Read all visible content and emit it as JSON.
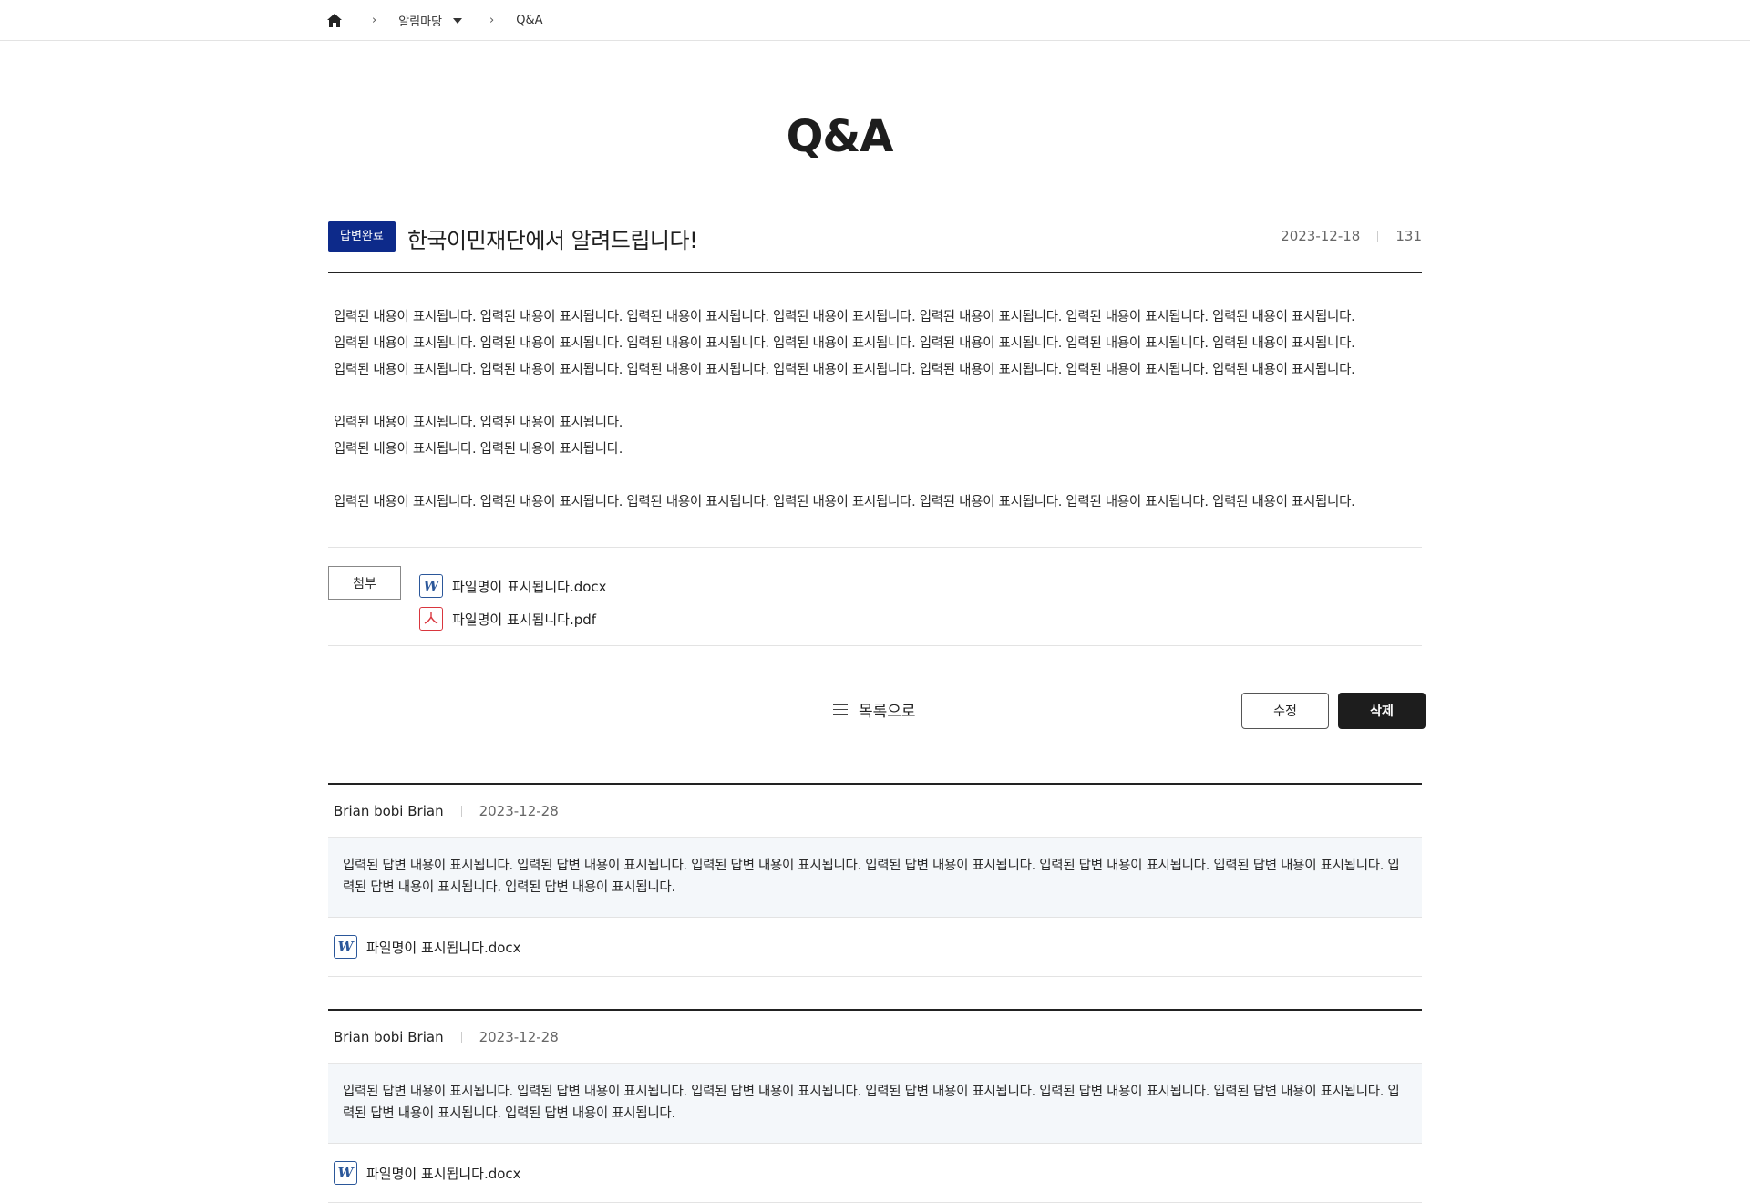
{
  "breadcrumb": {
    "home_icon": "home-icon",
    "section_label": "알림마당",
    "current_label": "Q&A"
  },
  "page": {
    "title": "Q&A"
  },
  "post": {
    "status_badge": "답변완료",
    "title": "한국이민재단에서 알려드립니다!",
    "date": "2023-12-18",
    "views": "131",
    "body": {
      "line1": "입력된 내용이 표시됩니다. 입력된 내용이 표시됩니다. 입력된 내용이 표시됩니다. 입력된 내용이 표시됩니다. 입력된 내용이 표시됩니다. 입력된 내용이 표시됩니다. 입력된 내용이 표시됩니다.",
      "line2": "입력된 내용이 표시됩니다. 입력된 내용이 표시됩니다. 입력된 내용이 표시됩니다. 입력된 내용이 표시됩니다. 입력된 내용이 표시됩니다. 입력된 내용이 표시됩니다. 입력된 내용이 표시됩니다.",
      "line3": "입력된 내용이 표시됩니다. 입력된 내용이 표시됩니다. 입력된 내용이 표시됩니다. 입력된 내용이 표시됩니다. 입력된 내용이 표시됩니다. 입력된 내용이 표시됩니다. 입력된 내용이 표시됩니다.",
      "line4": "입력된 내용이 표시됩니다. 입력된 내용이 표시됩니다.",
      "line5": "입력된 내용이 표시됩니다. 입력된 내용이 표시됩니다.",
      "line6": "입력된 내용이 표시됩니다. 입력된 내용이 표시됩니다. 입력된 내용이 표시됩니다. 입력된 내용이 표시됩니다. 입력된 내용이 표시됩니다. 입력된 내용이 표시됩니다. 입력된 내용이 표시됩니다."
    },
    "attachment_label": "첨부",
    "files": [
      {
        "name": "파일명이 표시됩니다.docx",
        "icon": "word-file-icon",
        "glyph": "W"
      },
      {
        "name": "파일명이 표시됩니다.pdf",
        "icon": "pdf-file-icon",
        "glyph": "⅄"
      }
    ]
  },
  "actions": {
    "list_label": "목록으로",
    "edit_label": "수정",
    "delete_label": "삭제"
  },
  "replies": [
    {
      "author": "Brian bobi Brian",
      "date": "2023-12-28",
      "body": "입력된 답변 내용이 표시됩니다. 입력된 답변 내용이 표시됩니다. 입력된 답변 내용이 표시됩니다. 입력된 답변 내용이 표시됩니다. 입력된 답변 내용이 표시됩니다. 입력된 답변 내용이 표시됩니다. 입력된 답변 내용이 표시됩니다. 입력된 답변 내용이 표시됩니다.",
      "file": "파일명이 표시됩니다.docx"
    },
    {
      "author": "Brian bobi Brian",
      "date": "2023-12-28",
      "body": "입력된 답변 내용이 표시됩니다. 입력된 답변 내용이 표시됩니다. 입력된 답변 내용이 표시됩니다. 입력된 답변 내용이 표시됩니다. 입력된 답변 내용이 표시됩니다. 입력된 답변 내용이 표시됩니다. 입력된 답변 내용이 표시됩니다. 입력된 답변 내용이 표시됩니다.",
      "file": "파일명이 표시됩니다.docx"
    }
  ],
  "colors": {
    "badge_bg": "#0d2a8a",
    "delete_bg": "#1d1d1d",
    "reply_bg": "#f4f7fa",
    "word_icon": "#2b579a",
    "pdf_icon": "#d9363e"
  }
}
